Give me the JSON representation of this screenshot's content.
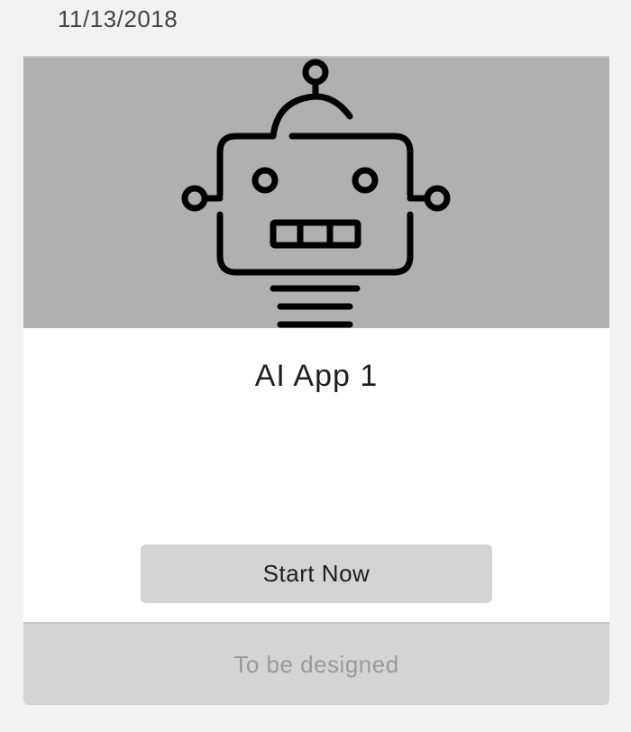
{
  "date": "11/13/2018",
  "card": {
    "title": "AI App 1",
    "image_icon": "robot-icon",
    "start_button_label": "Start Now",
    "footer_text": "To be designed"
  },
  "colors": {
    "page_background": "#f2f2f2",
    "hero_background": "#b0b0b0",
    "button_background": "#d4d4d4",
    "footer_background": "#d4d4d4",
    "footer_text": "#9a9a9a"
  }
}
